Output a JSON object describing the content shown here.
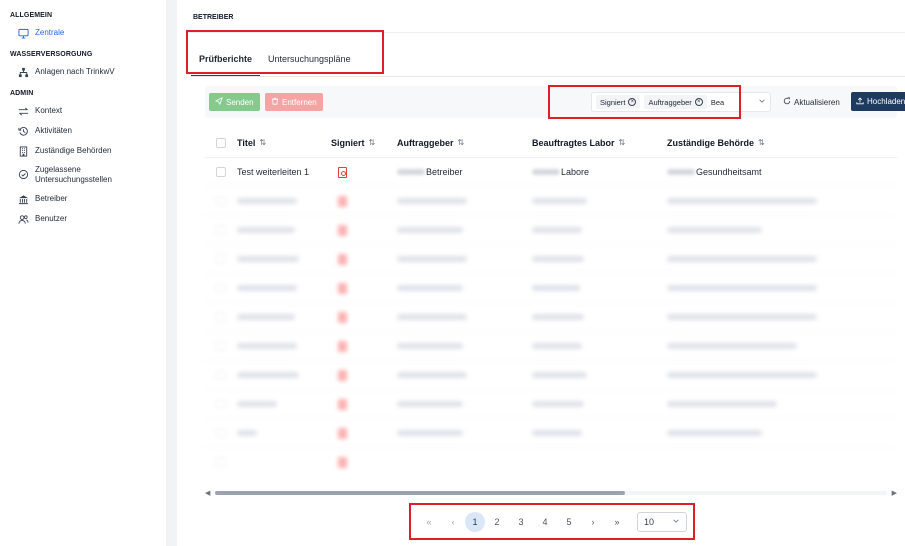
{
  "sidebar": {
    "sections": [
      {
        "title": "ALLGEMEIN",
        "items": [
          {
            "label": "Zentrale",
            "icon": "monitor-icon",
            "active": true
          }
        ]
      },
      {
        "title": "WASSERVERSORGUNG",
        "items": [
          {
            "label": "Anlagen nach TrinkwV",
            "icon": "sitemap-icon"
          }
        ]
      },
      {
        "title": "ADMIN",
        "items": [
          {
            "label": "Kontext",
            "icon": "swap-icon"
          },
          {
            "label": "Aktivitäten",
            "icon": "history-icon"
          },
          {
            "label": "Zuständige Behörden",
            "icon": "building-icon"
          },
          {
            "label": "Zugelassene Untersuchungsstellen",
            "icon": "check-circle-icon"
          },
          {
            "label": "Betreiber",
            "icon": "bank-icon"
          },
          {
            "label": "Benutzer",
            "icon": "users-icon"
          }
        ]
      }
    ]
  },
  "breadcrumb": "BETREIBER",
  "tabs": [
    {
      "label": "Prüfberichte",
      "active": true
    },
    {
      "label": "Untersuchungspläne",
      "active": false
    }
  ],
  "toolbar": {
    "send_label": "Senden",
    "remove_label": "Entfernen",
    "filter_chips": [
      "Signiert",
      "Auftraggeber",
      "Bea"
    ],
    "refresh_label": "Aktualisieren",
    "upload_label": "Hochladen"
  },
  "table": {
    "headers": [
      "Titel",
      "Signiert",
      "Auftraggeber",
      "Beauftragtes Labor",
      "Zuständige Behörde"
    ],
    "first_row": {
      "title": "Test weiterleiten 1",
      "auftraggeber": "Betreiber",
      "labor": "Labore",
      "behoerde": "Gesundheitsamt"
    },
    "blurred_rows": 10
  },
  "pagination": {
    "pages": [
      "1",
      "2",
      "3",
      "4",
      "5"
    ],
    "current": "1",
    "rows_per_page": "10",
    "first": "«",
    "prev": "‹",
    "next": "›",
    "last": "»"
  },
  "colors": {
    "accent": "#2563eb",
    "primary_dark": "#1e3a5f",
    "send_green": "#86c98c",
    "remove_red": "#f6a3a3",
    "highlight_red": "#e11d2a"
  }
}
